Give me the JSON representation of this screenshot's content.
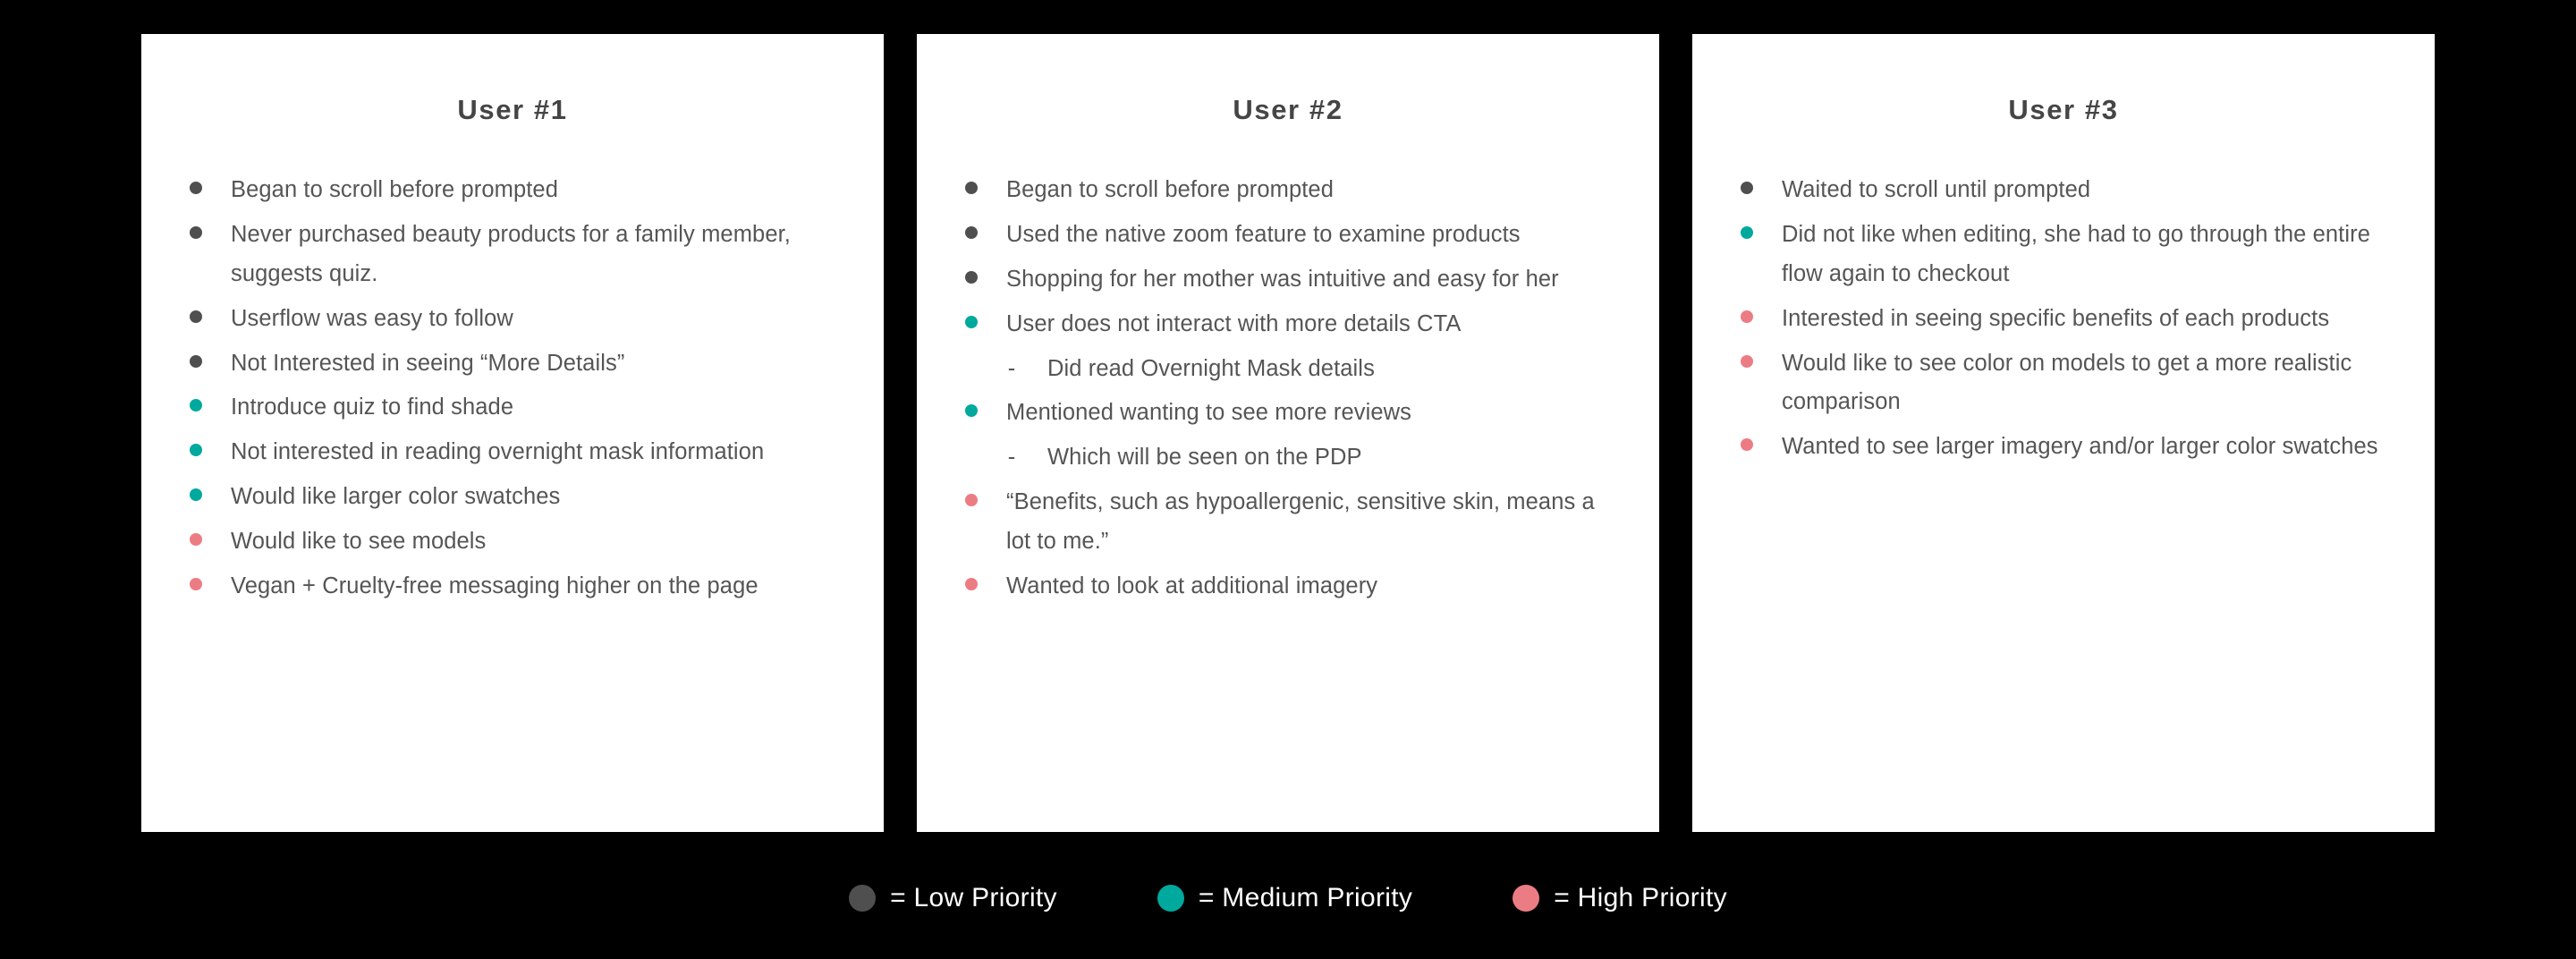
{
  "theme": {
    "background": "#000000",
    "card_background": "#FFFFFF",
    "title_color": "#454545",
    "body_color": "#555555",
    "legend_text_color": "#FFFFFF",
    "priority_colors": {
      "low": "#4F4F4F",
      "medium": "#00A99D",
      "high": "#EC7C83"
    }
  },
  "cards": [
    {
      "title": "User #1",
      "items": [
        {
          "priority": "low",
          "text": "Began to scroll before prompted"
        },
        {
          "priority": "low",
          "text": "Never purchased beauty products for a family member, suggests quiz."
        },
        {
          "priority": "low",
          "text": "Userflow was easy to follow"
        },
        {
          "priority": "low",
          "text": "Not Interested in seeing “More Details”"
        },
        {
          "priority": "medium",
          "text": "Introduce quiz to find shade"
        },
        {
          "priority": "medium",
          "text": "Not interested in reading overnight mask information"
        },
        {
          "priority": "medium",
          "text": "Would like larger color swatches"
        },
        {
          "priority": "high",
          "text": "Would like to see models"
        },
        {
          "priority": "high",
          "text": "Vegan + Cruelty-free messaging higher on the page"
        }
      ]
    },
    {
      "title": "User #2",
      "items": [
        {
          "priority": "low",
          "text": "Began to scroll before prompted"
        },
        {
          "priority": "low",
          "text": "Used the native zoom feature to examine products"
        },
        {
          "priority": "low",
          "text": "Shopping for her mother was intuitive and easy for her"
        },
        {
          "priority": "medium",
          "text": "User does not interact with more details CTA"
        },
        {
          "priority": "sub",
          "text": "Did read Overnight Mask details"
        },
        {
          "priority": "medium",
          "text": "Mentioned wanting to see more reviews"
        },
        {
          "priority": "sub",
          "text": "Which will be seen on the PDP"
        },
        {
          "priority": "high",
          "text": "“Benefits, such as hypoallergenic, sensitive skin, means a lot to me.”"
        },
        {
          "priority": "high",
          "text": "Wanted to look at additional imagery"
        }
      ]
    },
    {
      "title": "User #3",
      "items": [
        {
          "priority": "low",
          "text": "Waited to scroll until prompted"
        },
        {
          "priority": "medium",
          "text": "Did not like when editing, she had to go through the entire flow again to checkout"
        },
        {
          "priority": "high",
          "text": "Interested in seeing specific benefits of each products"
        },
        {
          "priority": "high",
          "text": "Would like to see color on models to get a more realistic comparison"
        },
        {
          "priority": "high",
          "text": "Wanted to see larger imagery and/or larger color swatches"
        }
      ]
    }
  ],
  "legend": {
    "entries": [
      {
        "priority": "low",
        "label": "= Low Priority"
      },
      {
        "priority": "medium",
        "label": "= Medium Priority"
      },
      {
        "priority": "high",
        "label": "= High Priority"
      }
    ]
  }
}
